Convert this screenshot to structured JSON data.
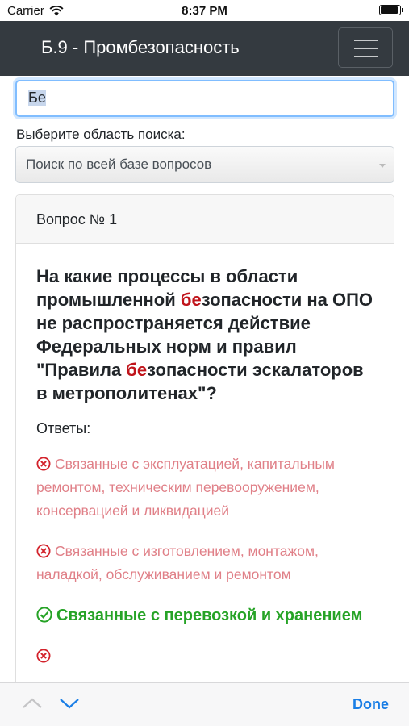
{
  "status_bar": {
    "carrier": "Carrier",
    "time": "8:37 PM"
  },
  "navbar": {
    "title": "Б.9 - Промбезопасность",
    "menu_icon": "hamburger-icon"
  },
  "search": {
    "value": "Бе"
  },
  "scope": {
    "label": "Выберите область поиска:",
    "selected": "Поиск по всей базе вопросов"
  },
  "question_card": {
    "header": "Вопрос № 1",
    "question_parts": {
      "p1": "На какие процессы в области промышленной ",
      "hl1": "бе",
      "p2": "зопасности на ОПО не распространяется действие Федеральных норм и правил \"Правила ",
      "hl2": "бе",
      "p3": "зопасности эскалаторов в метрополитенах\"?"
    },
    "answers_label": "Ответы:",
    "answers": [
      {
        "text": "Связанные с эксплуатацией, капитальным ремонтом, техническим перевооружением, консервацией и ликвидацией",
        "correct": false,
        "icon": "x-circle-icon"
      },
      {
        "text": "Связанные с изготовлением, монтажом, наладкой, обслуживанием и ремонтом",
        "correct": false,
        "icon": "x-circle-icon"
      },
      {
        "text": "Связанные с перевозкой и хранением",
        "correct": true,
        "icon": "check-circle-icon"
      },
      {
        "text": "",
        "correct": false,
        "icon": "x-circle-icon"
      }
    ]
  },
  "keyboard_toolbar": {
    "done": "Done",
    "prev_icon": "chevron-up-icon",
    "next_icon": "chevron-down-icon"
  },
  "colors": {
    "navbar": "#343a40",
    "highlight": "#c0141b",
    "wrong": "#e08088",
    "correct": "#26a326",
    "done": "#1a7ee6"
  }
}
